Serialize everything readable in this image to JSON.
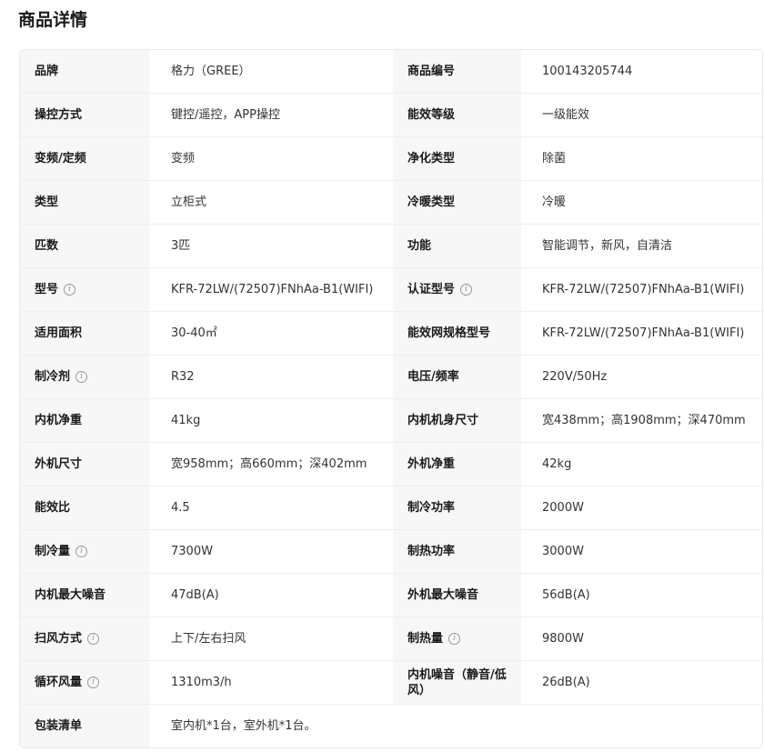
{
  "page": {
    "title": "商品详情"
  },
  "specs": {
    "rows": [
      {
        "left": {
          "label": "品牌",
          "value": "格力（GREE）",
          "info": false
        },
        "right": {
          "label": "商品编号",
          "value": "100143205744",
          "info": false
        }
      },
      {
        "left": {
          "label": "操控方式",
          "value": "键控/遥控，APP操控",
          "info": false
        },
        "right": {
          "label": "能效等级",
          "value": "一级能效",
          "info": false
        }
      },
      {
        "left": {
          "label": "变频/定频",
          "value": "变频",
          "info": false
        },
        "right": {
          "label": "净化类型",
          "value": "除菌",
          "info": false
        }
      },
      {
        "left": {
          "label": "类型",
          "value": "立柜式",
          "info": false
        },
        "right": {
          "label": "冷暖类型",
          "value": "冷暖",
          "info": false
        }
      },
      {
        "left": {
          "label": "匹数",
          "value": "3匹",
          "info": false
        },
        "right": {
          "label": "功能",
          "value": "智能调节，新风，自清洁",
          "info": false
        }
      },
      {
        "left": {
          "label": "型号",
          "value": "KFR-72LW/(72507)FNhAa-B1(WIFI)",
          "info": true
        },
        "right": {
          "label": "认证型号",
          "value": "KFR-72LW/(72507)FNhAa-B1(WIFI)",
          "info": true
        }
      },
      {
        "left": {
          "label": "适用面积",
          "value": "30-40㎡",
          "info": false
        },
        "right": {
          "label": "能效网规格型号",
          "value": "KFR-72LW/(72507)FNhAa-B1(WIFI)",
          "info": false
        }
      },
      {
        "left": {
          "label": "制冷剂",
          "value": "R32",
          "info": true
        },
        "right": {
          "label": "电压/频率",
          "value": "220V/50Hz",
          "info": false
        }
      },
      {
        "left": {
          "label": "内机净重",
          "value": "41kg",
          "info": false
        },
        "right": {
          "label": "内机机身尺寸",
          "value": "宽438mm；高1908mm；深470mm",
          "info": false
        }
      },
      {
        "left": {
          "label": "外机尺寸",
          "value": "宽958mm；高660mm；深402mm",
          "info": false
        },
        "right": {
          "label": "外机净重",
          "value": "42kg",
          "info": false
        }
      },
      {
        "left": {
          "label": "能效比",
          "value": "4.5",
          "info": false
        },
        "right": {
          "label": "制冷功率",
          "value": "2000W",
          "info": false
        }
      },
      {
        "left": {
          "label": "制冷量",
          "value": "7300W",
          "info": true
        },
        "right": {
          "label": "制热功率",
          "value": "3000W",
          "info": false
        }
      },
      {
        "left": {
          "label": "内机最大噪音",
          "value": "47dB(A)",
          "info": false
        },
        "right": {
          "label": "外机最大噪音",
          "value": "56dB(A)",
          "info": false
        }
      },
      {
        "left": {
          "label": "扫风方式",
          "value": "上下/左右扫风",
          "info": true
        },
        "right": {
          "label": "制热量",
          "value": "9800W",
          "info": true
        }
      },
      {
        "left": {
          "label": "循环风量",
          "value": "1310m3/h",
          "info": true
        },
        "right": {
          "label": "内机噪音（静音/低风）",
          "value": "26dB(A)",
          "info": false
        }
      }
    ],
    "full_row": {
      "label": "包装清单",
      "value": "室内机*1台，室外机*1台。"
    }
  },
  "icons": {
    "info": "info-circle-icon"
  }
}
